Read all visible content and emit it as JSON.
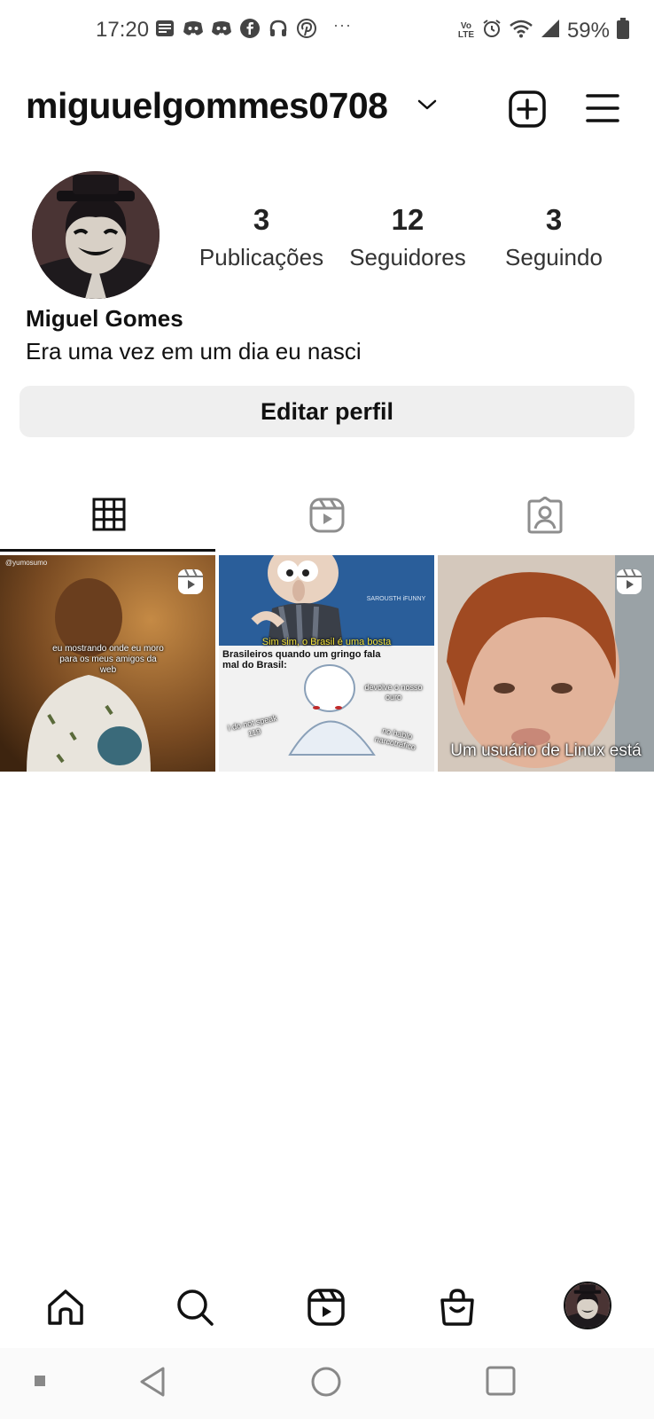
{
  "status_bar": {
    "time": "17:20",
    "notification_icons": [
      "news-icon",
      "discord-icon",
      "discord-icon",
      "facebook-icon",
      "headphones-icon",
      "pinterest-icon"
    ],
    "more": "···",
    "network": "Vo LTE",
    "battery": "59%"
  },
  "header": {
    "username": "miguuelgommes0708"
  },
  "profile": {
    "stats": [
      {
        "value": "3",
        "label": "Publicações"
      },
      {
        "value": "12",
        "label": "Seguidores"
      },
      {
        "value": "3",
        "label": "Seguindo"
      }
    ],
    "full_name": "Miguel Gomes",
    "bio": "Era uma vez em um dia eu nasci",
    "edit_button": "Editar perfil"
  },
  "tabs": [
    {
      "name": "grid-icon",
      "active": true
    },
    {
      "name": "reels-icon",
      "active": false
    },
    {
      "name": "tagged-icon",
      "active": false
    }
  ],
  "posts": [
    {
      "type": "reel",
      "watermark": "@yumosumo",
      "caption": "eu mostrando onde eu moro para os meus amigos da web",
      "bg": "#8a5a2a"
    },
    {
      "type": "image",
      "top_caption": "Sim sim, o Brasil é uma bosta",
      "watermark": "SAROUSTH iFUNNY",
      "heading": "Brasileiros quando um gringo fala mal do Brasil:",
      "bubble1": "devolve o nosso ouro",
      "bubble2": "I do not speak 119",
      "bubble3": "no hablo narcotráfico"
    },
    {
      "type": "reel",
      "caption": "Um usuário de Linux está",
      "bg": "#c9b7a8"
    }
  ],
  "bottom_nav": [
    "home-icon",
    "search-icon",
    "reels-icon",
    "shop-icon",
    "profile-avatar"
  ],
  "colors": {
    "text": "#111111",
    "button_bg": "#efefef",
    "meme_yellow": "#f2e13a"
  }
}
